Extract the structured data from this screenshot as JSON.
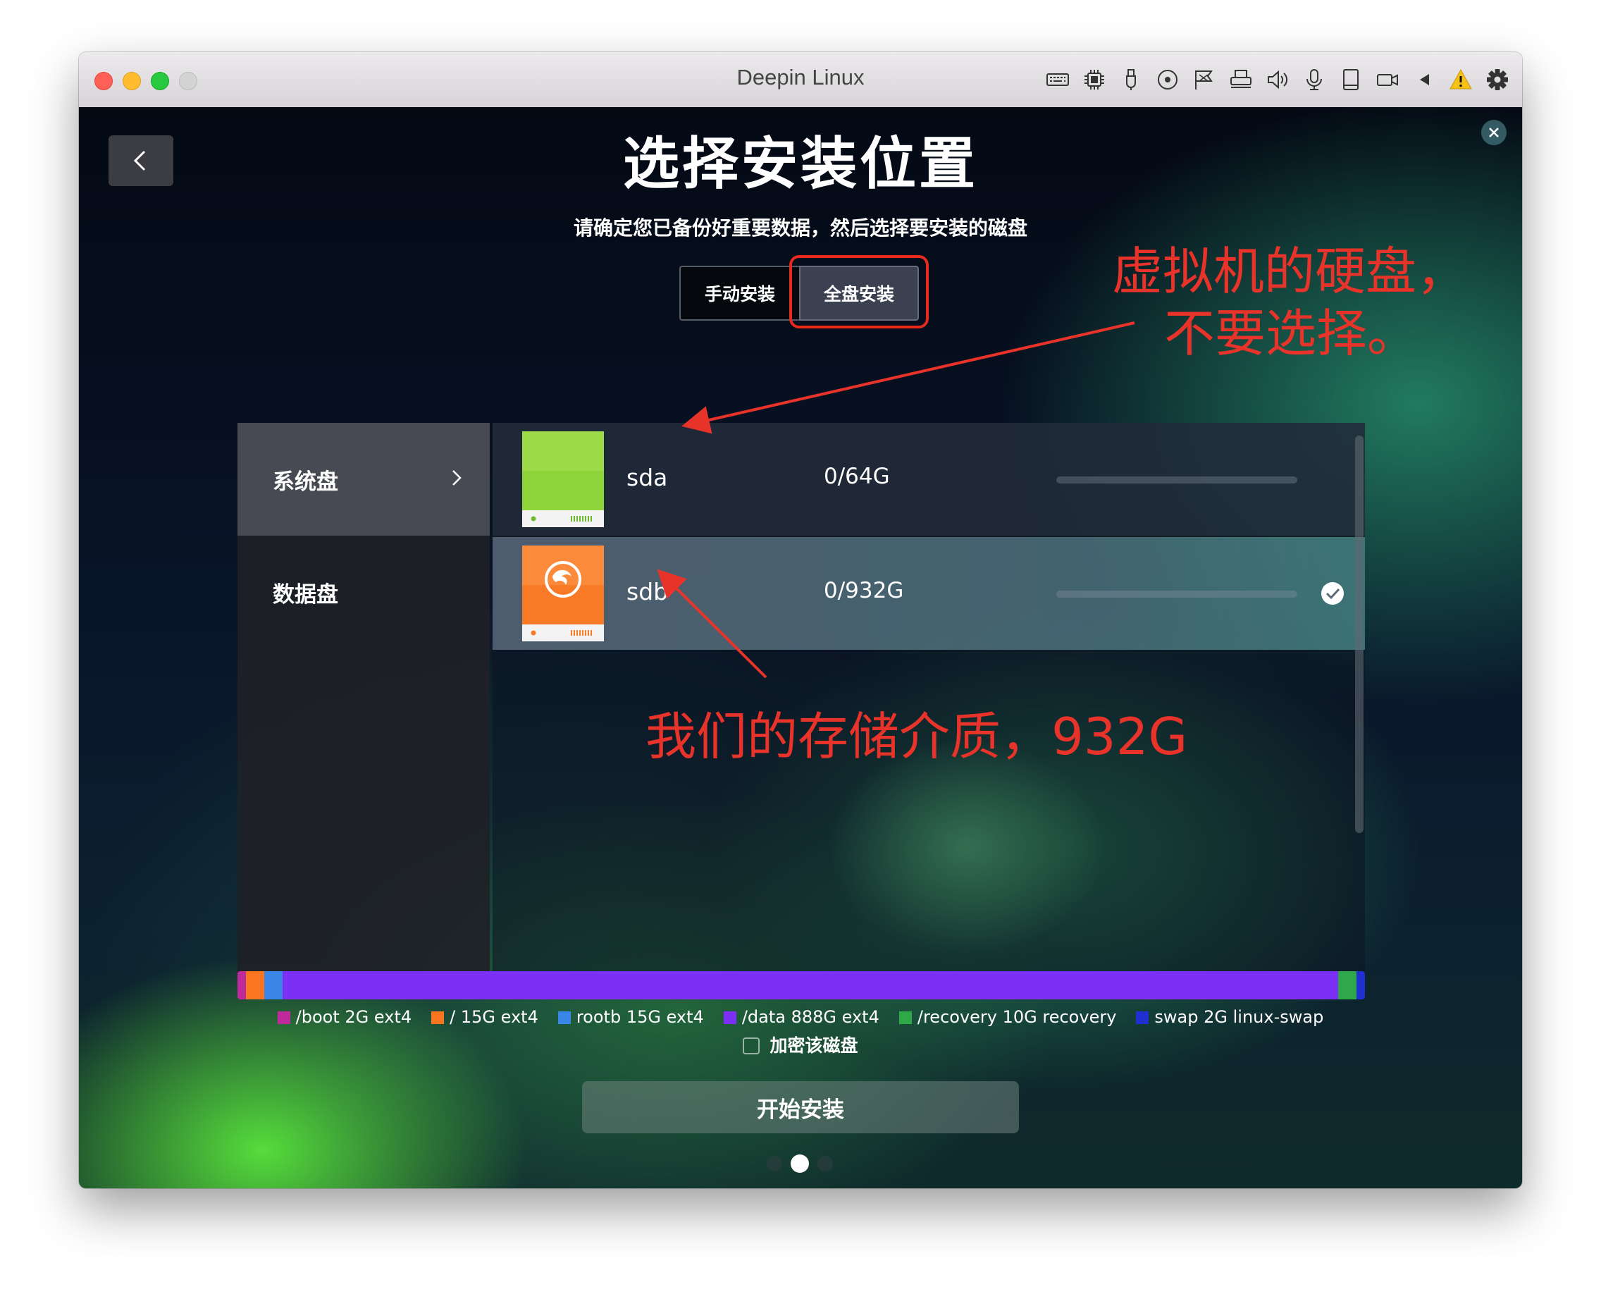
{
  "window": {
    "title": "Deepin Linux",
    "traffic_lights": [
      "#fe5f57",
      "#febc2e",
      "#28c840",
      "#d3d3d3"
    ]
  },
  "toolbar_icons": [
    "keyboard-icon",
    "cpu-icon",
    "usb-icon",
    "disc-icon",
    "network-icon",
    "printer-icon",
    "speaker-icon",
    "microphone-icon",
    "device-icon",
    "camera-icon",
    "triangle-left-icon",
    "warning-icon",
    "gear-icon"
  ],
  "installer": {
    "title": "选择安装位置",
    "subtitle": "请确定您已备份好重要数据，然后选择要安装的磁盘",
    "modes": {
      "manual": "手动安装",
      "full": "全盘安装",
      "selected": "全盘安装"
    },
    "categories": [
      {
        "label": "系统盘",
        "active": true
      },
      {
        "label": "数据盘",
        "active": false
      }
    ],
    "disks": [
      {
        "name": "sda",
        "size": "0/64G",
        "used_fraction": 0,
        "color": "#8fd43a",
        "selected": false
      },
      {
        "name": "sdb",
        "size": "0/932G",
        "used_fraction": 0,
        "color": "#f97a26",
        "selected": true
      }
    ],
    "partitions": [
      {
        "label": "/boot 2G ext4",
        "color": "#c0299c",
        "gb": 2
      },
      {
        "label": "/ 15G ext4",
        "color": "#f9751f",
        "gb": 15
      },
      {
        "label": "rootb 15G ext4",
        "color": "#3a86e8",
        "gb": 15
      },
      {
        "label": "/data 888G ext4",
        "color": "#7c2ff5",
        "gb": 888
      },
      {
        "label": "/recovery 10G recovery",
        "color": "#2fa84a",
        "gb": 10
      },
      {
        "label": "swap 2G linux-swap",
        "color": "#1f2fd0",
        "gb": 2
      }
    ],
    "encrypt_label": "加密该磁盘",
    "encrypt_checked": false,
    "install_button": "开始安装",
    "pager": {
      "total": 3,
      "current": 2
    }
  },
  "annotations": {
    "virtual_disk_line1": "虚拟机的硬盘，",
    "virtual_disk_line2": "不要选择。",
    "storage_media": "我们的存储介质，932G",
    "color": "#e8332a"
  }
}
